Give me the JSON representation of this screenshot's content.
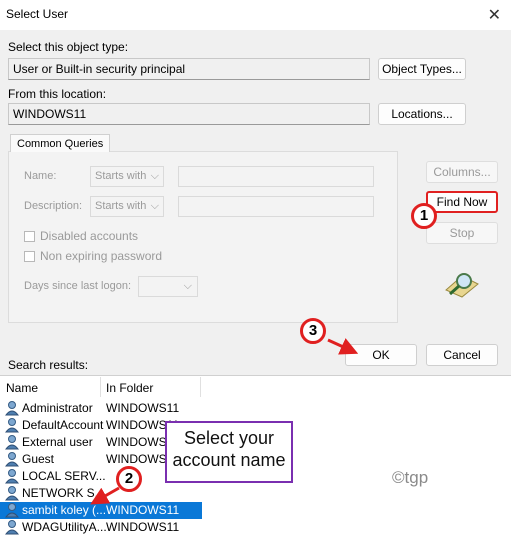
{
  "window": {
    "title": "Select User",
    "close_glyph": "✕"
  },
  "object_type": {
    "label": "Select this object type:",
    "value": "User or Built-in security principal",
    "button": "Object Types..."
  },
  "location": {
    "label": "From this location:",
    "value": "WINDOWS11",
    "button": "Locations..."
  },
  "queries": {
    "tab": "Common Queries",
    "name_label": "Name:",
    "name_mode": "Starts with",
    "description_label": "Description:",
    "description_mode": "Starts with",
    "disabled_label": "Disabled accounts",
    "nonexpiring_label": "Non expiring password",
    "days_label": "Days since last logon:"
  },
  "buttons": {
    "columns": "Columns...",
    "find_now": "Find Now",
    "stop": "Stop",
    "ok": "OK",
    "cancel": "Cancel"
  },
  "results": {
    "label": "Search results:",
    "col_name": "Name",
    "col_folder": "In Folder",
    "rows": [
      {
        "name": "Administrator",
        "folder": "WINDOWS11"
      },
      {
        "name": "DefaultAccount",
        "folder": "WINDOWS11"
      },
      {
        "name": "External user",
        "folder": "WINDOWS1"
      },
      {
        "name": "Guest",
        "folder": "WINDOWS1"
      },
      {
        "name": "LOCAL SERV...",
        "folder": ""
      },
      {
        "name": "NETWORK S...",
        "folder": ""
      },
      {
        "name": "sambit koley (...",
        "folder": "WINDOWS11"
      },
      {
        "name": "WDAGUtilityA...",
        "folder": "WINDOWS11"
      }
    ],
    "selected_index": 6
  },
  "annotations": {
    "step1": "1",
    "step2": "2",
    "step3": "3",
    "callout": "Select your account name",
    "watermark": "©tgp"
  },
  "colors": {
    "annotation_red": "#e02020",
    "callout_border": "#7a2fb0",
    "selection": "#0a78d7"
  }
}
